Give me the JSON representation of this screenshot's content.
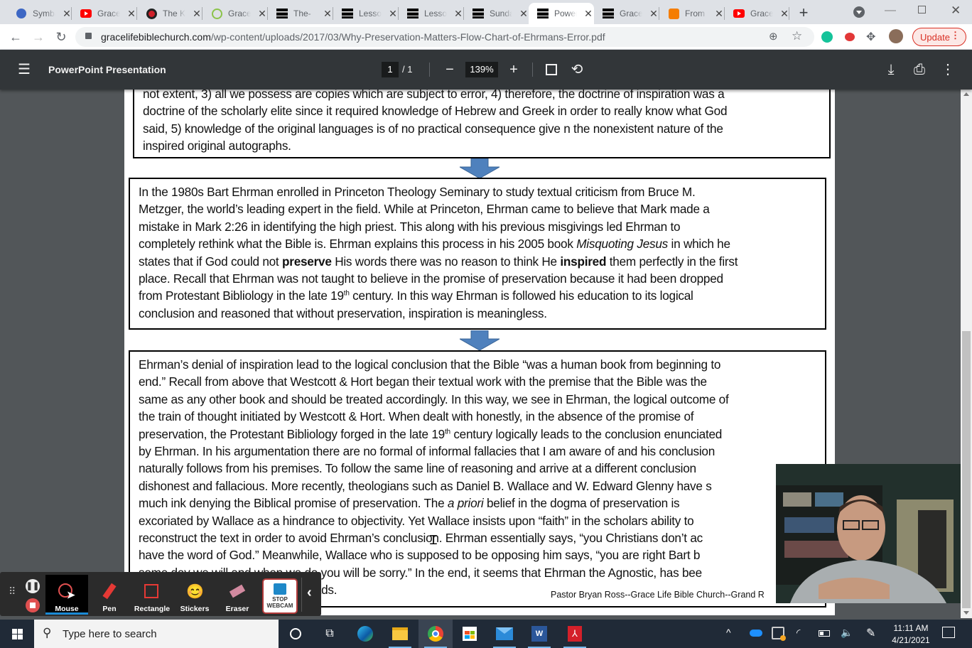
{
  "browser": {
    "tabs": [
      {
        "title": "Symbaloo",
        "icon": "symbaloo-icon"
      },
      {
        "title": "Grace Life",
        "icon": "youtube-icon"
      },
      {
        "title": "The KJV",
        "icon": "red-circle-logo-icon"
      },
      {
        "title": "Grace",
        "icon": "green-play-icon"
      },
      {
        "title": "The-",
        "icon": "document-bars-icon"
      },
      {
        "title": "Lessons",
        "icon": "document-bars-icon"
      },
      {
        "title": "Lessons",
        "icon": "document-bars-icon"
      },
      {
        "title": "Sunday",
        "icon": "document-bars-icon"
      },
      {
        "title": "PowerPoint",
        "icon": "document-bars-icon",
        "active": true
      },
      {
        "title": "Grace",
        "icon": "document-bars-icon"
      },
      {
        "title": "From",
        "icon": "blogger-icon"
      },
      {
        "title": "Grace",
        "icon": "youtube-icon"
      }
    ],
    "url_host": "gracelifebiblechurch.com",
    "url_path": "/wp-content/uploads/2017/03/Why-Preservation-Matters-Flow-Chart-of-Ehrmans-Error.pdf",
    "update_label": "Update"
  },
  "pdf_viewer": {
    "title": "PowerPoint Presentation",
    "current_page": "1",
    "total_pages": "/ 1",
    "zoom": "139%"
  },
  "document": {
    "box1_lines": [
      "not extent, 3) all we possess are copies which are subject to error, 4) therefore, the doctrine of inspiration was a",
      "doctrine of the scholarly elite since it required knowledge of Hebrew and Greek in order to really know what God",
      "said, 5) knowledge  of the original languages is of no practical consequence give n the nonexistent nature of the",
      "inspired original autographs."
    ],
    "box2": {
      "l1": "In the 1980s Bart Ehrman enrolled in Princeton Theology Seminary to study textual criticism from Bruce M.",
      "l2": "Metzger, the world’s leading expert in the field.  While at Princeton, Ehrman came to believe that Mark made a",
      "l3": "mistake in Mark 2:26 in identifying the high priest.  This along with his previous misgivings led Ehrman to",
      "l4a": "completely rethink what the Bible is.  Ehrman explains this process in his 2005 book ",
      "l4i": "Misquoting Jesus",
      "l4b": " in which he",
      "l5a": "states that if God could not ",
      "l5b1": "preserve",
      "l5c": " His words there was no reason to think He ",
      "l5b2": "inspired",
      "l5d": " them perfectly in the first",
      "l6": "place.  Recall that Ehrman was not taught to believe in the promise of preservation because it had been dropped",
      "l7a": "from Protestant Bibliology in the late 19",
      "l7sup": "th",
      "l7b": " century.  In this way Ehrman is followed his education to its logical",
      "l8": "conclusion and reasoned that without preservation, inspiration is meaningless."
    },
    "box3": {
      "l1": "Ehrman’s denial of inspiration lead to the logical conclusion that the Bible “was a human book from beginning to",
      "l2": "end.”  Recall from above that Westcott & Hort began their textual work with the premise that the Bible was the",
      "l3": "same as any other book and should be treated accordingly.  In this way, we see in Ehrman, the logical outcome of",
      "l4": "the train of thought initiated by Westcott & Hort. When dealt with honestly, in the absence of the promise of",
      "l5a": "preservation, the Protestant Bibliology forged in the late 19",
      "l5sup": "th",
      "l5b": " century logically leads to the conclusion enunciated",
      "l6": "by Ehrman.  In his argumentation there are no formal of informal fallacies that I am aware of and his conclusion",
      "l7": "naturally follows from his premises.   To follow the same line of reasoning and arrive at a different conclusion",
      "l8": "dishonest and fallacious.  More recently, theologians such as Daniel B. Wallace and W. Edward Glenny have s",
      "l9a": "much ink denying the Biblical promise of preservation.  The ",
      "l9i": "a priori",
      "l9b": " belief in the dogma of preservation is",
      "l10": "excoriated by Wallace as a hindrance to objectivity.  Yet Wallace insists upon “faith” in the scholars ability to",
      "l11": "reconstruct the text in order to avoid Ehrman’s conclusion.  Ehrman essentially says, “you Christians don’t ac",
      "l12": "have the word of God.”  Meanwhile, Wallace who is supposed to be opposing him says, “you are right Bart b",
      "l13": "some day we will and when we do you will be sorry.”  In the end, it seems that Ehrman the Agnostic, has bee",
      "l14": "where the prevailing Orthodoxy leads."
    },
    "credit": "Pastor Bryan Ross--Grace Life Bible Church--Grand R"
  },
  "recorder": {
    "tools": [
      {
        "label": "Mouse",
        "active": true
      },
      {
        "label": "Pen"
      },
      {
        "label": "Rectangle"
      },
      {
        "label": "Stickers"
      },
      {
        "label": "Eraser"
      }
    ],
    "stop_webcam": "STOP WEBCAM"
  },
  "taskbar": {
    "search_placeholder": "Type here to search",
    "time": "11:11 AM",
    "date": "4/21/2021"
  },
  "colors": {
    "arrow_blue": "#4f81bd",
    "update_red": "#d93025",
    "pdf_toolbar": "#323639"
  }
}
